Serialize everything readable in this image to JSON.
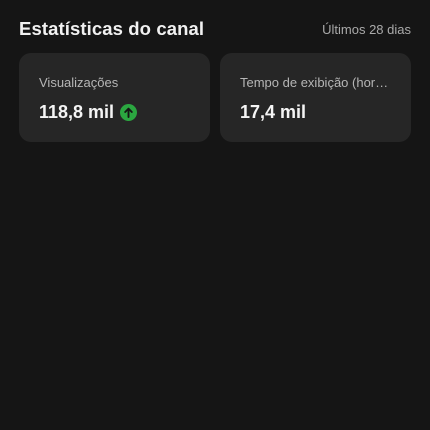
{
  "header": {
    "title": "Estatísticas do canal",
    "range": "Últimos 28 dias"
  },
  "cards": [
    {
      "label": "Visualizações",
      "value": "118,8 mil",
      "trend_icon": "arrow-up-circle-icon",
      "trend_color": "#2ba640"
    },
    {
      "label": "Tempo de exibição (horas)",
      "value": "17,4 mil"
    }
  ],
  "colors": {
    "background": "#151515",
    "card": "#262626",
    "trend_up": "#2ba640"
  }
}
